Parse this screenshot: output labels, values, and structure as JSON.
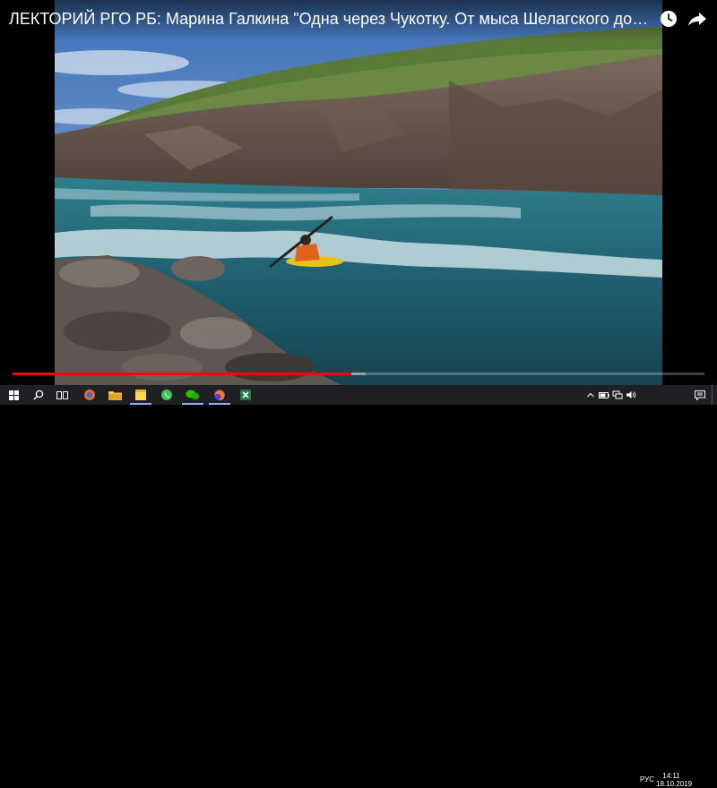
{
  "video": {
    "title": "ЛЕКТОРИЙ РГО РБ: Марина Галкина \"Одна через Чукотку. От мыса Шелагского до мыса Дежнева\"",
    "progress_played": 0.49,
    "progress_loaded": 0.51,
    "icons": {
      "watch_later": "clock-icon",
      "share": "share-arrow-icon"
    }
  },
  "colors": {
    "progress_red": "#ff0000",
    "taskbar_bg": "#1f1f24"
  },
  "taskbar": {
    "apps": [
      {
        "name": "windows-start-icon"
      },
      {
        "name": "search-icon"
      },
      {
        "name": "task-view-icon"
      },
      {
        "name": "app-orange-icon"
      },
      {
        "name": "file-explorer-icon"
      },
      {
        "name": "sticky-notes-icon"
      },
      {
        "name": "whatsapp-icon"
      },
      {
        "name": "wechat-icon"
      },
      {
        "name": "firefox-icon"
      },
      {
        "name": "excel-icon"
      }
    ],
    "tray": {
      "language": "РУС",
      "time": "14:11",
      "date": "18.10.2019"
    }
  }
}
